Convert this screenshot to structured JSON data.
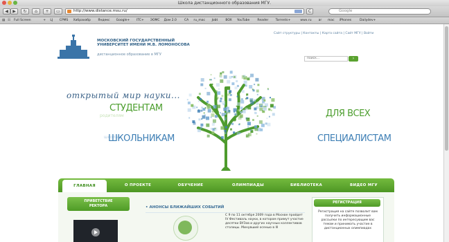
{
  "window": {
    "title": "Школа дистанционного образования МГУ."
  },
  "toolbar": {
    "url": "http://www.distance.msu.ru/",
    "search_placeholder": "Google"
  },
  "bookmarks": [
    "Full Screen",
    "+",
    "LJ",
    "CPMS",
    "Хабрахабр",
    "Яндекс",
    "Google+",
    "ITC+",
    "ЭОМС",
    "Дом 2.0",
    "СА",
    "ru_mac",
    "Jobt",
    "BOX",
    "YouTube",
    "Reader",
    "Torrents+",
    "wwx.ru",
    "ar",
    "mac",
    "iPhones",
    "Dailydev+"
  ],
  "site": {
    "top_links": "Сайт структуры  |  Контакты  |  Карта сайта  |  Сайт МГУ  |  Войти",
    "logo_line1": "МОСКОВСКИЙ ГОСУДАРСТВЕННЫЙ",
    "logo_line2": "УНИВЕРСИТЕТ ИМЕНИ М.В. ЛОМОНОСОВА",
    "logo_sub": "дистанционное образование в МГУ",
    "search_placeholder": "поиск...",
    "slogan": "открытый мир науки...",
    "studentam": "СТУДЕНТАМ",
    "shkolnikam": "ШКОЛЬНИКАМ",
    "dlya_vseh": "ДЛЯ ВСЕХ",
    "specialistam": "СПЕЦИАЛИСТАМ",
    "ghost1": "родителям",
    "ghost2": "школам"
  },
  "nav": {
    "items": [
      "ГЛАВНАЯ",
      "О ПРОЕКТЕ",
      "ОБУЧЕНИЕ",
      "ОЛИМПИАДЫ",
      "БИБЛИОТЕКА",
      "ВИДЕО МГУ"
    ]
  },
  "left": {
    "head_line1": "ПРИВЕТСТВИЕ",
    "head_line2": "РЕКТОРА"
  },
  "center": {
    "announce": "АНОНСЫ БЛИЖАЙШИХ СОБЫТИЙ",
    "news": "С 9 по 11 октября 2009 года в Москве пройдет IV Фестиваль науки, в котором примут участие десятки ВУЗов и других научных коллективов столицы. Минувший осенью в III"
  },
  "right": {
    "head": "РЕГИСТРАЦИЯ",
    "text": "Регистрация на сайте позволит вам получить информационные рассылки по интересующим вас темам и принимать участие в дистанционных олимпиадах"
  },
  "colors": {
    "accent_green": "#4d9624",
    "brand_blue": "#3e7fb5"
  }
}
